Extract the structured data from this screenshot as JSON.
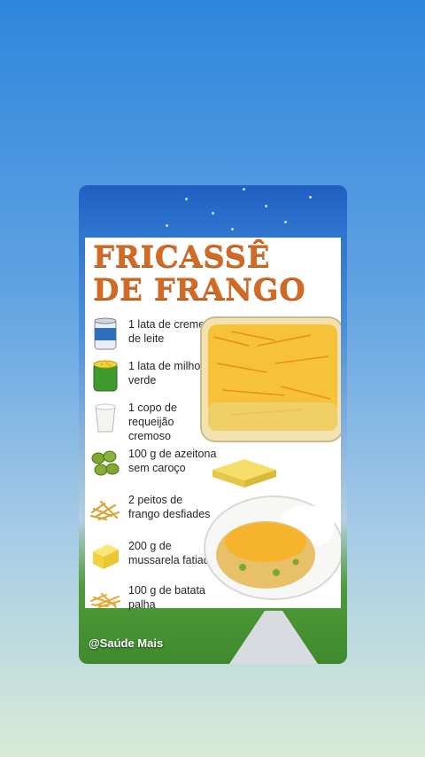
{
  "post": {
    "title": "FRICASSÊ\nDE FRANGO",
    "handle": "@Saúde Mais"
  },
  "ingredients": [
    {
      "text": "1 lata de creme de leite",
      "icon": "cream-can-icon"
    },
    {
      "text": "1 lata de milho verde",
      "icon": "corn-can-icon"
    },
    {
      "text": "1 copo de requeijão cremoso",
      "icon": "cream-cheese-cup-icon"
    },
    {
      "text": "100 g de azeitona sem caroço",
      "icon": "olives-icon"
    },
    {
      "text": "2 peitos de frango desfiades",
      "icon": "shredded-chicken-icon"
    },
    {
      "text": "200 g de mussarela fatiada",
      "icon": "cheese-block-icon"
    },
    {
      "text": "100 g de batata palha",
      "icon": "potato-sticks-icon"
    }
  ],
  "colors": {
    "title": "#d36a24",
    "background_top": "#2f86dc",
    "background_bottom": "#d8ebd6"
  }
}
